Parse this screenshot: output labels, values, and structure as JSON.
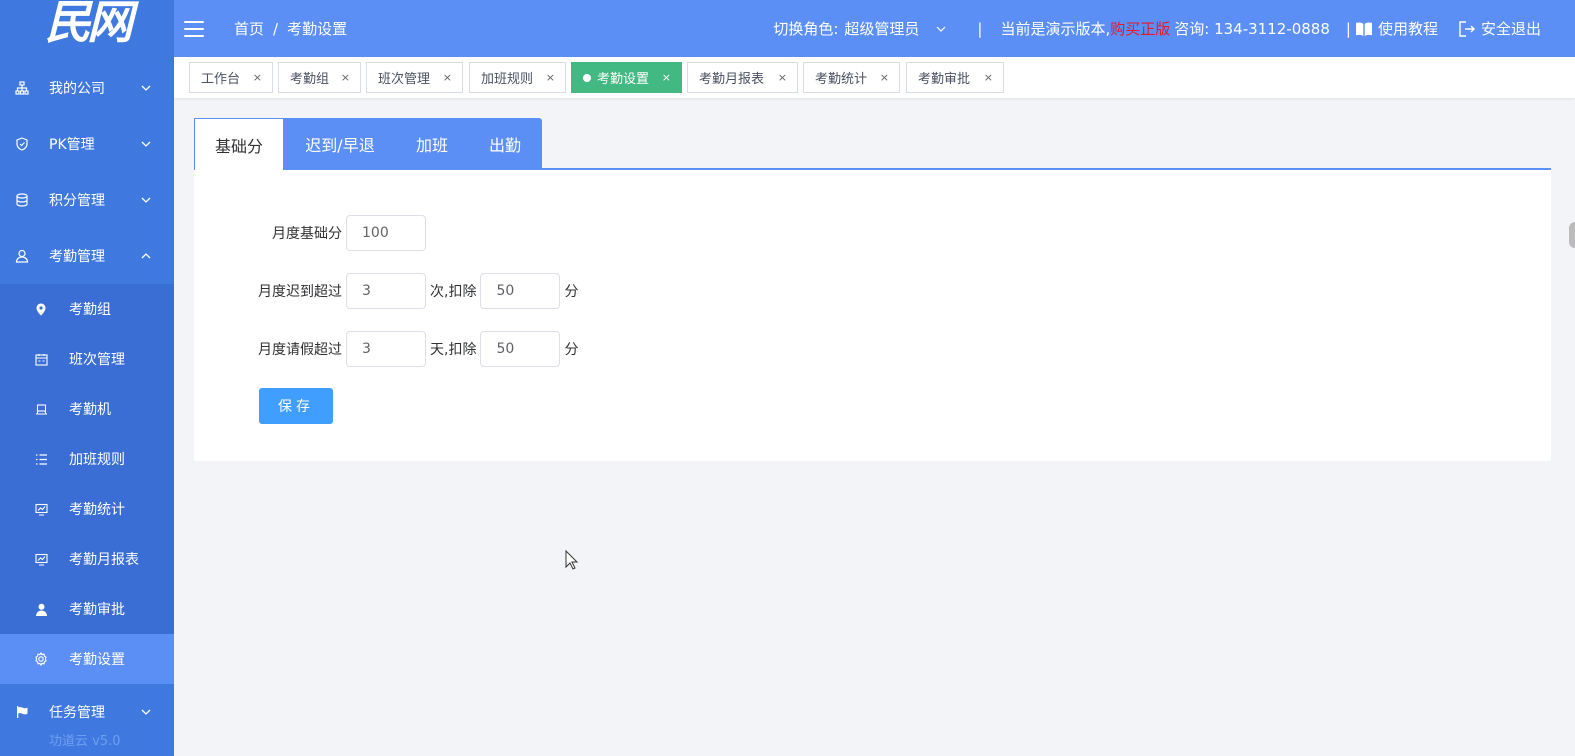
{
  "logo": {
    "text": "民网"
  },
  "sidebar": {
    "menus": [
      {
        "label": "我的公司",
        "icon": "org-chart-icon",
        "expanded": false
      },
      {
        "label": "PK管理",
        "icon": "shield-icon",
        "expanded": false
      },
      {
        "label": "积分管理",
        "icon": "database-icon",
        "expanded": false
      },
      {
        "label": "考勤管理",
        "icon": "user-icon",
        "expanded": true
      }
    ],
    "sub_items": [
      {
        "label": "考勤组",
        "icon": "location-pin-icon"
      },
      {
        "label": "班次管理",
        "icon": "calendar-icon"
      },
      {
        "label": "考勤机",
        "icon": "device-icon"
      },
      {
        "label": "加班规则",
        "icon": "list-icon"
      },
      {
        "label": "考勤统计",
        "icon": "chart-icon"
      },
      {
        "label": "考勤月报表",
        "icon": "chart-icon"
      },
      {
        "label": "考勤审批",
        "icon": "person-icon"
      },
      {
        "label": "考勤设置",
        "icon": "gear-icon",
        "active": true
      }
    ],
    "task_menu": {
      "label": "任务管理",
      "icon": "flag-icon"
    },
    "version": "功道云 v5.0"
  },
  "header": {
    "breadcrumb": [
      "首页",
      "考勤设置"
    ],
    "breadcrumb_sep": "/",
    "role_label": "切换角色:",
    "role_value": "超级管理员",
    "divider": "|",
    "demo_text": "当前是演示版本,",
    "buy_link": "购买正版",
    "consult_text": "咨询: 134-3112-0888",
    "divider2": "|",
    "tutorial": "使用教程",
    "logout": "安全退出"
  },
  "tabs": [
    {
      "label": "工作台",
      "active": false
    },
    {
      "label": "考勤组",
      "active": false
    },
    {
      "label": "班次管理",
      "active": false
    },
    {
      "label": "加班规则",
      "active": false
    },
    {
      "label": "考勤设置",
      "active": true
    },
    {
      "label": "考勤月报表",
      "active": false
    },
    {
      "label": "考勤统计",
      "active": false
    },
    {
      "label": "考勤审批",
      "active": false
    }
  ],
  "tab_close": "×",
  "inner_tabs": [
    "基础分",
    "迟到/早退",
    "加班",
    "出勤"
  ],
  "form": {
    "base_label": "月度基础分",
    "base_value": "100",
    "late_label": "月度迟到超过",
    "late_count": "3",
    "late_unit": "次,扣除",
    "late_deduct": "50",
    "late_suffix": "分",
    "leave_label": "月度请假超过",
    "leave_count": "3",
    "leave_unit": "天,扣除",
    "leave_deduct": "50",
    "leave_suffix": "分",
    "save_label": "保存"
  },
  "colors": {
    "sidebar": "#3f79e0",
    "header": "#5b8ff5",
    "active_tab": "#42b983",
    "primary_button": "#409eff",
    "buy_link": "#e8172b"
  }
}
